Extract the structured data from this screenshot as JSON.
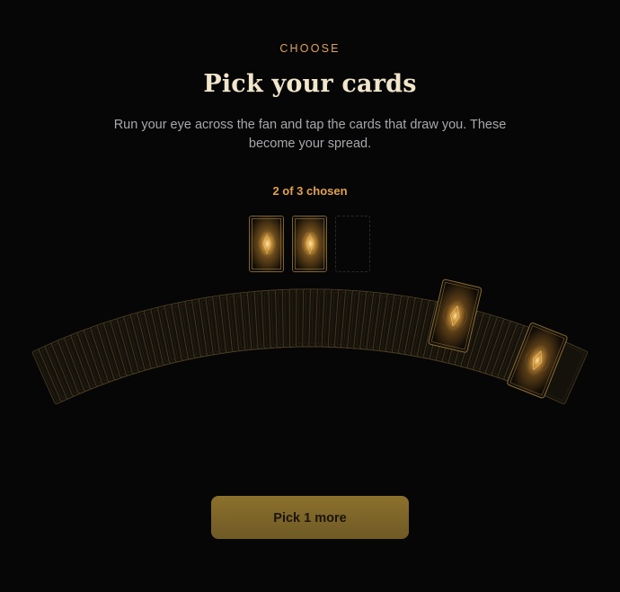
{
  "header": {
    "eyebrow": "CHOOSE",
    "title": "Pick your cards",
    "subtitle": "Run your eye across the fan and tap the cards that draw you. These become your spread."
  },
  "selection": {
    "count_label": "2 of 3 chosen",
    "chosen": 2,
    "total": 3
  },
  "deck": {
    "lifted_cards": 2
  },
  "action": {
    "button_label": "Pick 1 more"
  },
  "colors": {
    "background": "#060606",
    "accent": "#e0a24e",
    "title": "#f1e5cb",
    "button": "#8c702c"
  }
}
